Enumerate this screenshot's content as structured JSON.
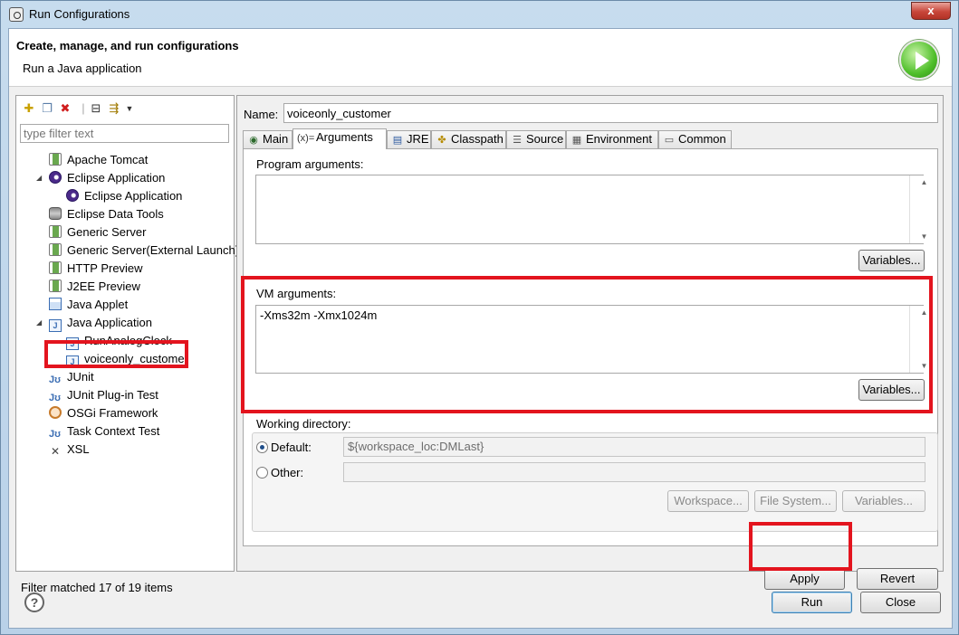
{
  "window": {
    "title": "Run Configurations",
    "close_glyph": "x"
  },
  "header": {
    "title": "Create, manage, and run configurations",
    "subtitle": "Run a Java application",
    "icon": "run-icon"
  },
  "left": {
    "filter_placeholder": "type filter text",
    "status": "Filter matched 17 of 19 items",
    "tree": [
      {
        "label": "Apache Tomcat",
        "icon": "server-icon",
        "level": 1
      },
      {
        "label": "Eclipse Application",
        "icon": "eclipse-icon",
        "level": 1,
        "expanded": true
      },
      {
        "label": "Eclipse Application",
        "icon": "eclipse-icon",
        "level": 2
      },
      {
        "label": "Eclipse Data Tools",
        "icon": "database-icon",
        "level": 1
      },
      {
        "label": "Generic Server",
        "icon": "server-icon",
        "level": 1
      },
      {
        "label": "Generic Server(External Launch)",
        "icon": "server-icon",
        "level": 1
      },
      {
        "label": "HTTP Preview",
        "icon": "server-icon",
        "level": 1
      },
      {
        "label": "J2EE Preview",
        "icon": "server-icon",
        "level": 1
      },
      {
        "label": "Java Applet",
        "icon": "applet-icon",
        "level": 1
      },
      {
        "label": "Java Application",
        "icon": "java-app-icon",
        "level": 1,
        "expanded": true
      },
      {
        "label": "RunAnalogClock",
        "icon": "java-app-icon",
        "level": 2
      },
      {
        "label": "voiceonly_customer",
        "icon": "java-app-icon",
        "level": 2,
        "selected": true
      },
      {
        "label": "JUnit",
        "icon": "junit-icon",
        "level": 1
      },
      {
        "label": "JUnit Plug-in Test",
        "icon": "junit-icon",
        "level": 1
      },
      {
        "label": "OSGi Framework",
        "icon": "osgi-icon",
        "level": 1
      },
      {
        "label": "Task Context Test",
        "icon": "junit-icon",
        "level": 1
      },
      {
        "label": "XSL",
        "icon": "xsl-icon",
        "level": 1
      }
    ]
  },
  "right": {
    "name_label": "Name:",
    "name_value": "voiceonly_customer",
    "tabs": [
      {
        "label": "Main"
      },
      {
        "label": "Arguments",
        "active": true
      },
      {
        "label": "JRE"
      },
      {
        "label": "Classpath"
      },
      {
        "label": "Source"
      },
      {
        "label": "Environment"
      },
      {
        "label": "Common"
      }
    ],
    "program_args_label": "Program arguments:",
    "program_args_value": "",
    "vm_args_label": "VM arguments:",
    "vm_args_value": "-Xms32m -Xmx1024m",
    "variables_label": "Variables...",
    "working_dir_label": "Working directory:",
    "default_label": "Default:",
    "default_value": "${workspace_loc:DMLast}",
    "other_label": "Other:",
    "other_value": "",
    "workspace_btn": "Workspace...",
    "filesystem_btn": "File System...",
    "variables_btn": "Variables...",
    "apply": "Apply",
    "revert": "Revert"
  },
  "footer": {
    "help_glyph": "?",
    "run": "Run",
    "close": "Close"
  },
  "colors": {
    "highlight": "#e3141e"
  }
}
